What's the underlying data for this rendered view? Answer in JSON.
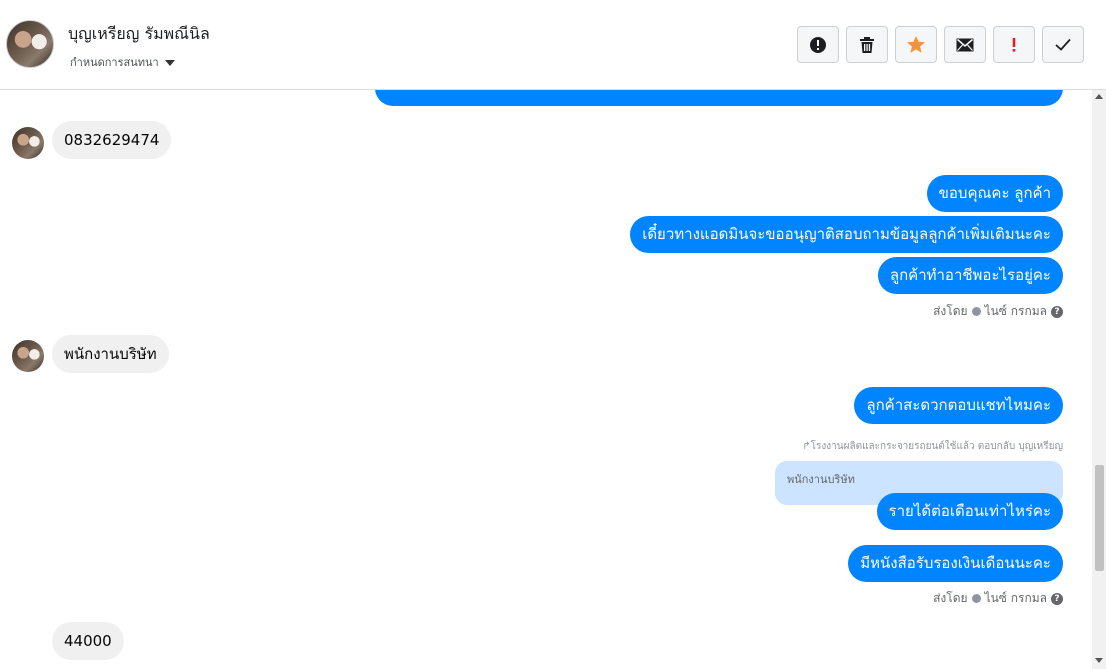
{
  "header": {
    "name": "บุญเหรียญ รัมพณีนิล",
    "subtitle": "กำหนดการสนทนา"
  },
  "toolbar": {
    "buttons": [
      {
        "icon": "alert-circle-icon",
        "label": "Spam"
      },
      {
        "icon": "trash-icon",
        "label": "Delete"
      },
      {
        "icon": "star-icon",
        "label": "Star",
        "color": "#f7923a"
      },
      {
        "icon": "envelope-icon",
        "label": "Mark unread"
      },
      {
        "icon": "exclamation-icon",
        "label": "Follow up",
        "color": "#e02020"
      },
      {
        "icon": "checkmark-icon",
        "label": "Done"
      }
    ]
  },
  "messages": [
    {
      "dir": "in",
      "text": "0832629474"
    },
    {
      "dir": "out",
      "text": "ขอบคุณคะ ลูกค้า"
    },
    {
      "dir": "out",
      "text": "เดี๋ยวทางแอดมินจะขออนุญาติสอบถามข้อมูลลูกค้าเพิ่มเติมนะคะ"
    },
    {
      "dir": "out",
      "text": "ลูกค้าทำอาชีพอะไรอยู่คะ"
    },
    {
      "dir": "in",
      "text": "พนักงานบริษัท"
    },
    {
      "dir": "out",
      "text": "ลูกค้าสะดวกตอบแชทไหมคะ"
    },
    {
      "dir": "out",
      "text": "รายได้ต่อเดือนเท่าไหร่คะ"
    },
    {
      "dir": "out",
      "text": "มีหนังสือรับรองเงินเดือนนะคะ"
    },
    {
      "dir": "in",
      "text": "44000"
    }
  ],
  "sent_by": {
    "prefix": "ส่งโดย",
    "agent": "ไนซ์ กรกมล"
  },
  "reply": {
    "meta": "โรงงานผลิตและกระจายรถยนต์ใช้แล้ว ตอบกลับ บุญเหรียญ",
    "quoted_text": "พนักงานบริษัท"
  },
  "colors": {
    "outgoing_bubble": "#0084ff",
    "incoming_bubble": "#f0f0f0",
    "reply_quote": "#cce4ff"
  }
}
